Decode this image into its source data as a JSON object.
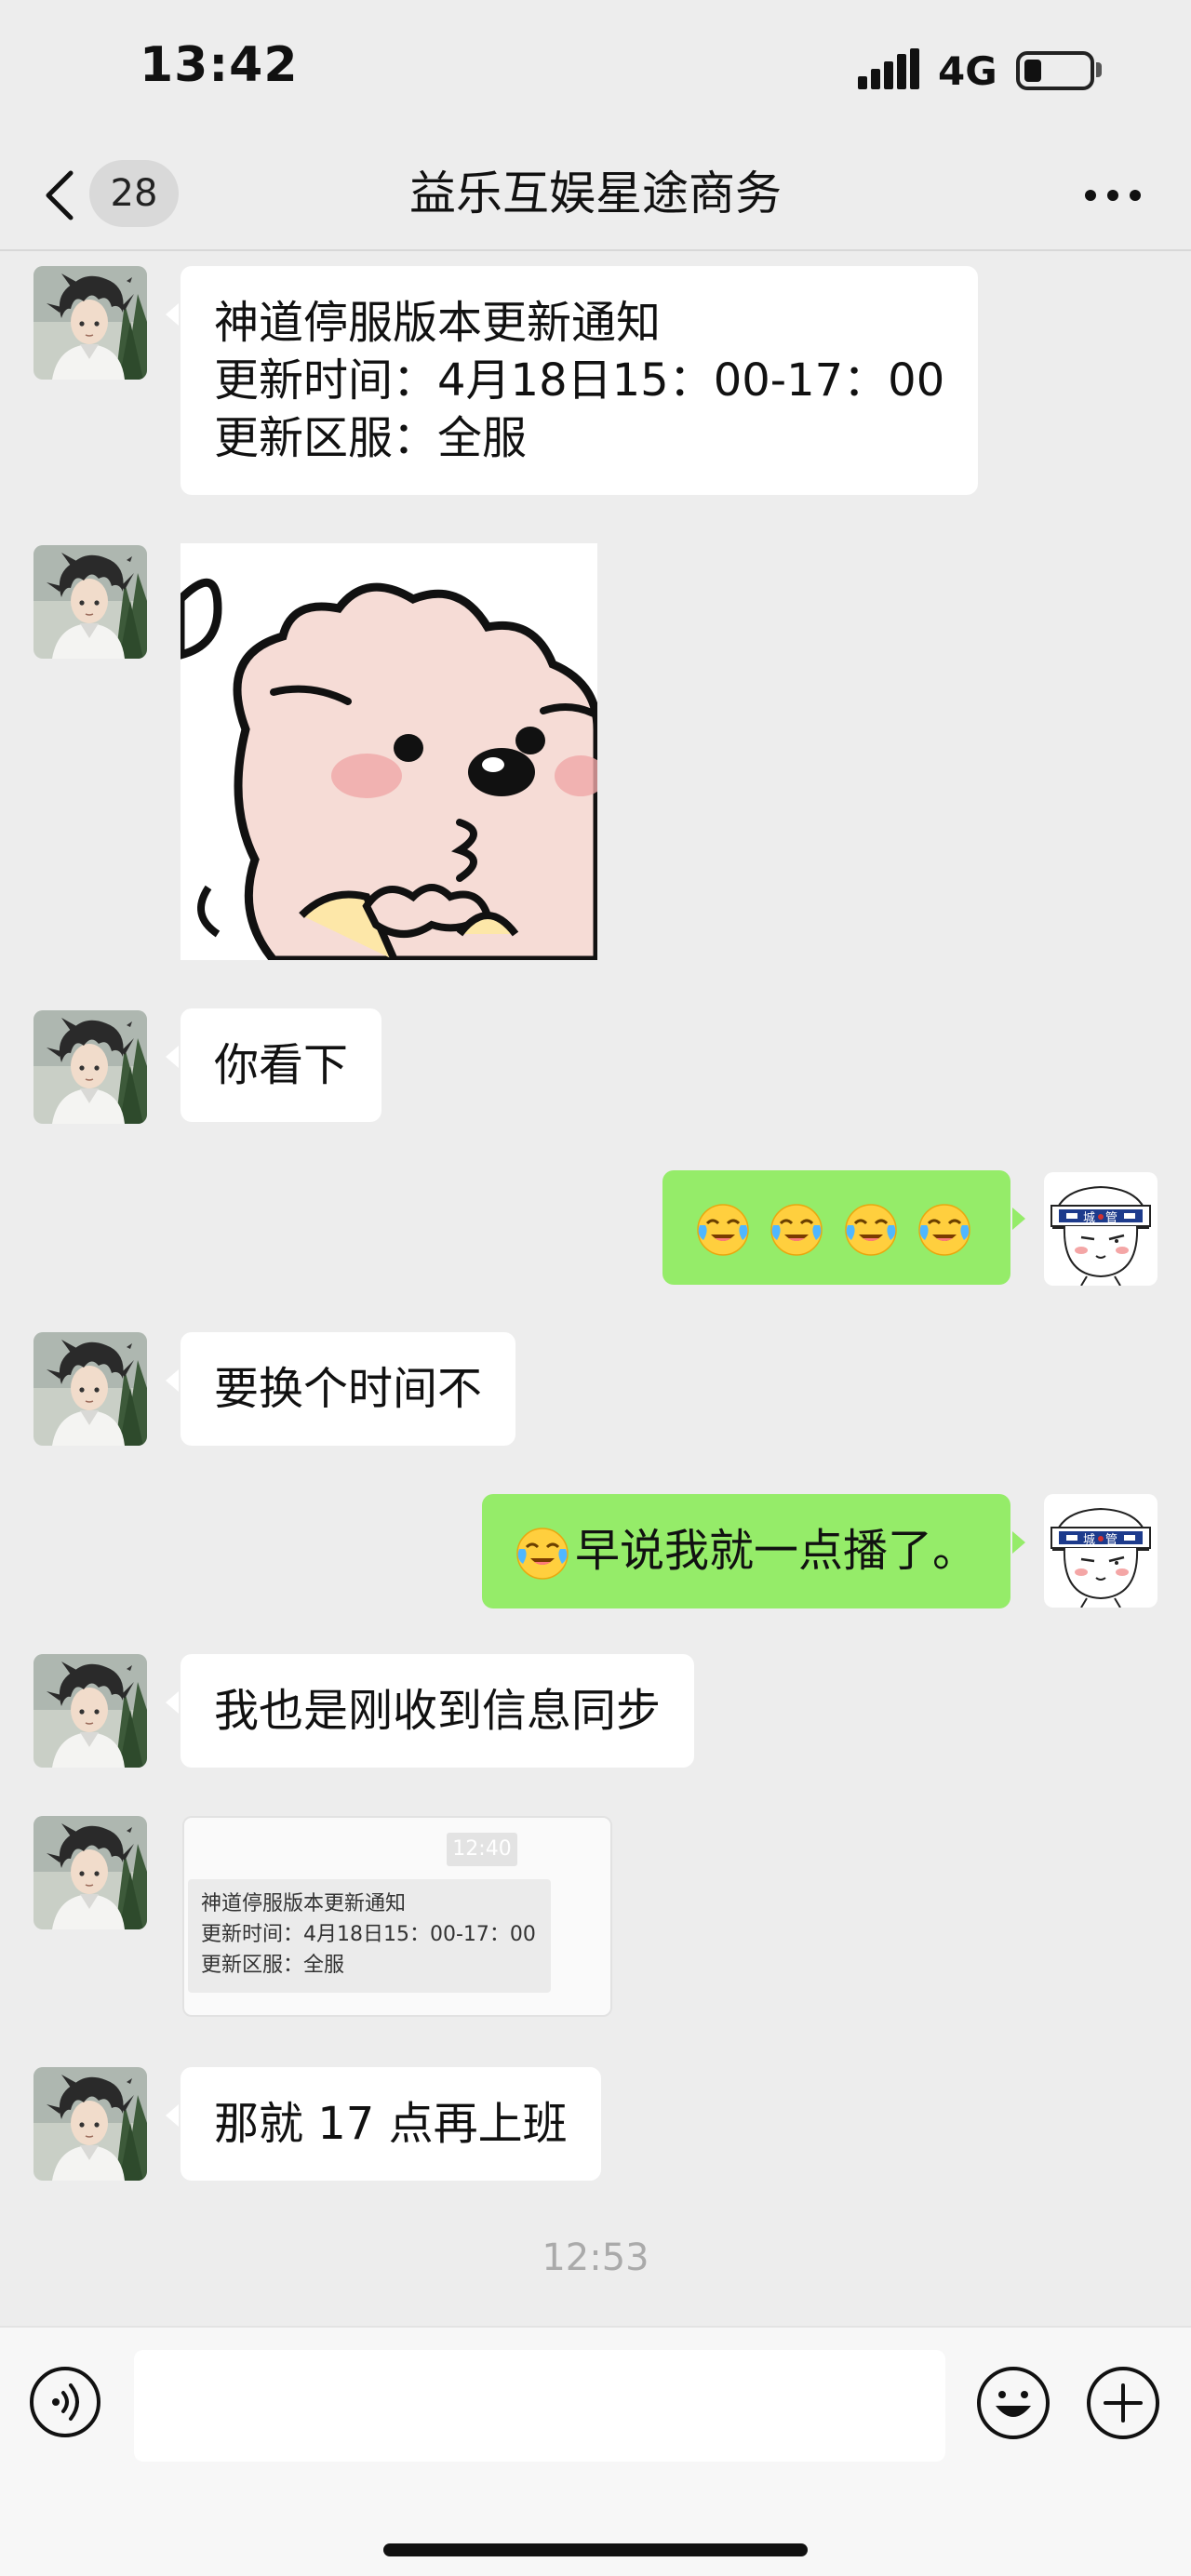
{
  "status_bar": {
    "time": "13:42",
    "network": "4G",
    "icons": [
      "signal-icon",
      "battery-icon"
    ]
  },
  "nav": {
    "title": "益乐互娱星途商务",
    "unread_count": "28",
    "icons": [
      "back-chevron-icon",
      "more-dots-icon"
    ]
  },
  "messages": [
    {
      "side": "in",
      "type": "text",
      "lines": [
        "神道停服版本更新通知",
        "更新时间：4月18日15：00-17：00",
        "更新区服：全服"
      ]
    },
    {
      "side": "in",
      "type": "sticker",
      "sticker": "sheep-sticker"
    },
    {
      "side": "in",
      "type": "text",
      "lines": [
        "你看下"
      ]
    },
    {
      "side": "out",
      "type": "emoji",
      "emoji": [
        "crying-laughing-emoji",
        "crying-laughing-emoji",
        "crying-laughing-emoji",
        "crying-laughing-emoji"
      ]
    },
    {
      "side": "in",
      "type": "text",
      "lines": [
        "要换个时间不"
      ]
    },
    {
      "side": "out",
      "type": "text",
      "emoji": "crying-laughing-emoji",
      "lines": [
        "早说我就一点播了。"
      ]
    },
    {
      "side": "in",
      "type": "text",
      "lines": [
        "我也是刚收到信息同步"
      ]
    },
    {
      "side": "in",
      "type": "forwarded-screenshot",
      "time": "12:40",
      "lines": [
        "神道停服版本更新通知",
        "更新时间：4月18日15：00-17：00",
        "更新区服：全服"
      ]
    },
    {
      "side": "in",
      "type": "text",
      "lines": [
        "那就 17 点再上班"
      ]
    }
  ],
  "timestamp": "12:53",
  "input_bar": {
    "value": "",
    "icons": [
      "voice-icon",
      "emoji-face-icon",
      "plus-icon"
    ]
  },
  "colors": {
    "background": "#ededed",
    "outgoing_bubble": "#95ec69",
    "incoming_bubble": "#ffffff",
    "timestamp": "#aaaaaa"
  },
  "avatars": {
    "contact": "anime-boy-avatar",
    "self": "chengguan-helmet-avatar"
  }
}
